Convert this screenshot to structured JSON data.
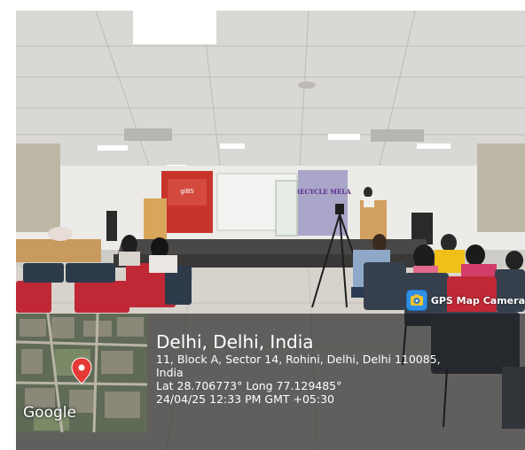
{
  "photo": {
    "stage_banner": "RECYCLE MELA",
    "logo_text": "giBS"
  },
  "app_badge": {
    "name": "GPS Map Camera",
    "icon": "gps-map-camera-icon"
  },
  "map": {
    "provider_label": "Google",
    "pin_icon": "map-pin-icon",
    "pin_color": "#e53935"
  },
  "location": {
    "place": "Delhi, Delhi, India",
    "address_line1": "11, Block A, Sector 14, Rohini, Delhi, Delhi 110085,",
    "address_line2": "India",
    "coordinates": "Lat 28.706773° Long 77.129485°",
    "timestamp": "24/04/25 12:33 PM GMT +05:30"
  }
}
